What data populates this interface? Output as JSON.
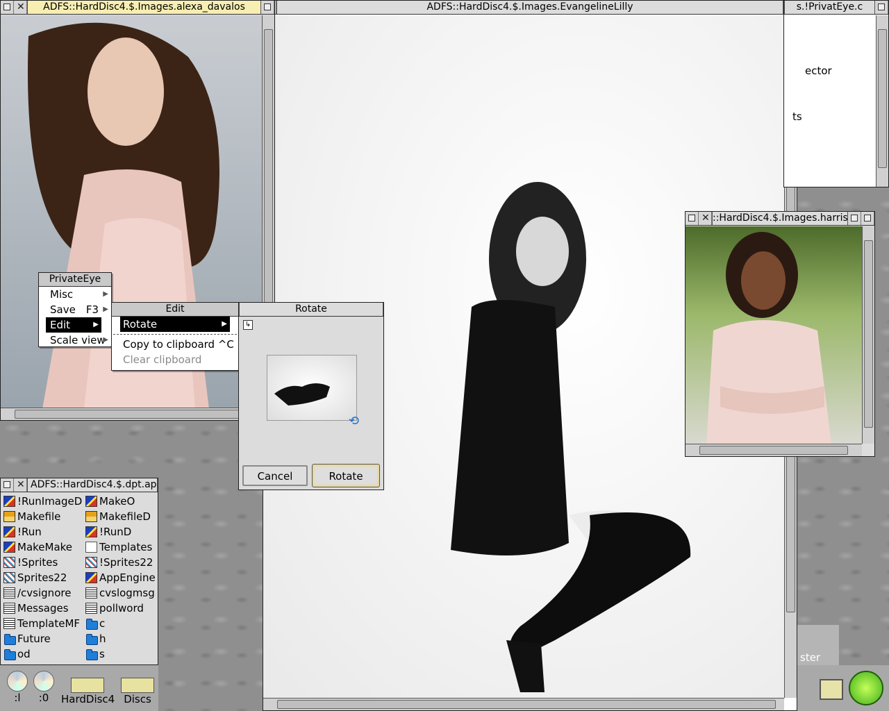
{
  "windows": {
    "alexa": {
      "title": "ADFS::HardDisc4.$.Images.alexa_davalos"
    },
    "evangeline": {
      "title": "ADFS::HardDisc4.$.Images.EvangelineLilly"
    },
    "privateeye": {
      "title": "s.!PrivatEye.c",
      "text1": "ector",
      "text2": "ts"
    },
    "harris": {
      "title": "::HardDisc4.$.Images.harris"
    },
    "filer": {
      "title": "ADFS::HardDisc4.$.dpt.ap",
      "col1": [
        {
          "name": "!RunImageD",
          "icon": "app"
        },
        {
          "name": "Makefile",
          "icon": "make"
        },
        {
          "name": "!Run",
          "icon": "app"
        },
        {
          "name": "MakeMake",
          "icon": "app"
        },
        {
          "name": "!Sprites",
          "icon": "sprite"
        },
        {
          "name": "Sprites22",
          "icon": "sprite"
        },
        {
          "name": "/cvsignore",
          "icon": "obey"
        },
        {
          "name": "Messages",
          "icon": "obey"
        },
        {
          "name": "TemplateMF",
          "icon": "obey"
        },
        {
          "name": "Future",
          "icon": "dir"
        },
        {
          "name": "od",
          "icon": "dir"
        }
      ],
      "col2": [
        {
          "name": "MakeO",
          "icon": "app"
        },
        {
          "name": "MakefileD",
          "icon": "make"
        },
        {
          "name": "!RunD",
          "icon": "app"
        },
        {
          "name": "Templates",
          "icon": "text"
        },
        {
          "name": "!Sprites22",
          "icon": "sprite"
        },
        {
          "name": "AppEngine",
          "icon": "app"
        },
        {
          "name": "cvslogmsg",
          "icon": "obey"
        },
        {
          "name": "pollword",
          "icon": "obey"
        },
        {
          "name": "c",
          "icon": "dir"
        },
        {
          "name": "h",
          "icon": "dir"
        },
        {
          "name": "s",
          "icon": "dir"
        }
      ]
    }
  },
  "menus": {
    "main": {
      "title": "PrivateEye",
      "misc": "Misc",
      "save": "Save",
      "save_key": "F3",
      "edit": "Edit",
      "scale": "Scale view"
    },
    "edit": {
      "title": "Edit",
      "rotate": "Rotate",
      "copy": "Copy to clipboard ^C",
      "clear": "Clear clipboard"
    }
  },
  "dialog": {
    "title": "Rotate",
    "cancel": "Cancel",
    "rotate": "Rotate"
  },
  "iconbar": {
    "cd1": ":l",
    "cd2": ":0",
    "hd": "HardDisc4",
    "discs": "Discs",
    "partial": "ster"
  },
  "colors": {
    "title_focus": "#f7eeb2",
    "selection": "#000000",
    "folder": "#1f7fd8"
  }
}
